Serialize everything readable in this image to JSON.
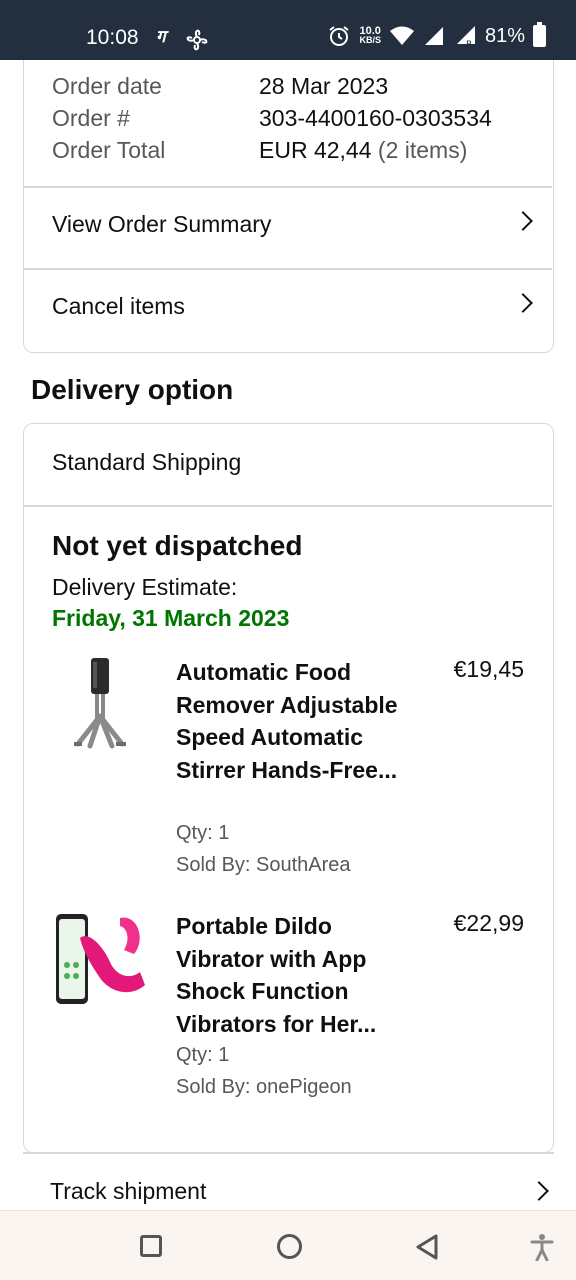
{
  "status_bar": {
    "time": "10:08",
    "speed_value": "10.0",
    "speed_unit": "KB/S",
    "battery": "81%"
  },
  "order": {
    "date_label": "Order date",
    "date_value": "28 Mar 2023",
    "number_label": "Order #",
    "number_value": "303-4400160-0303534",
    "total_label": "Order Total",
    "total_value": "EUR 42,44",
    "total_items": "(2 items)",
    "view_summary": "View Order Summary",
    "cancel_items": "Cancel items"
  },
  "delivery": {
    "section_title": "Delivery option",
    "shipping_method": "Standard Shipping",
    "status": "Not yet dispatched",
    "estimate_label": "Delivery Estimate:",
    "estimate_date": "Friday, 31 March 2023",
    "estimate_color": "#007600",
    "items": [
      {
        "title": "Automatic Food Remover Adjustable Speed Automatic Stirrer Hands-Free...",
        "price": "€19,45",
        "qty": "Qty: 1",
        "seller": "Sold By: SouthArea",
        "image_icon": "stirrer-product-image"
      },
      {
        "title": "Portable Dildo Vibrator with App Shock Function Vibrators for Her...",
        "price": "€22,99",
        "qty": "Qty: 1",
        "seller": "Sold By: onePigeon",
        "image_icon": "vibrator-product-image"
      }
    ]
  },
  "track_shipment": "Track shipment",
  "colors": {
    "status_bar": "#232f3e",
    "border": "#d5d9d9",
    "nav_bar": "#fbf5f1"
  }
}
